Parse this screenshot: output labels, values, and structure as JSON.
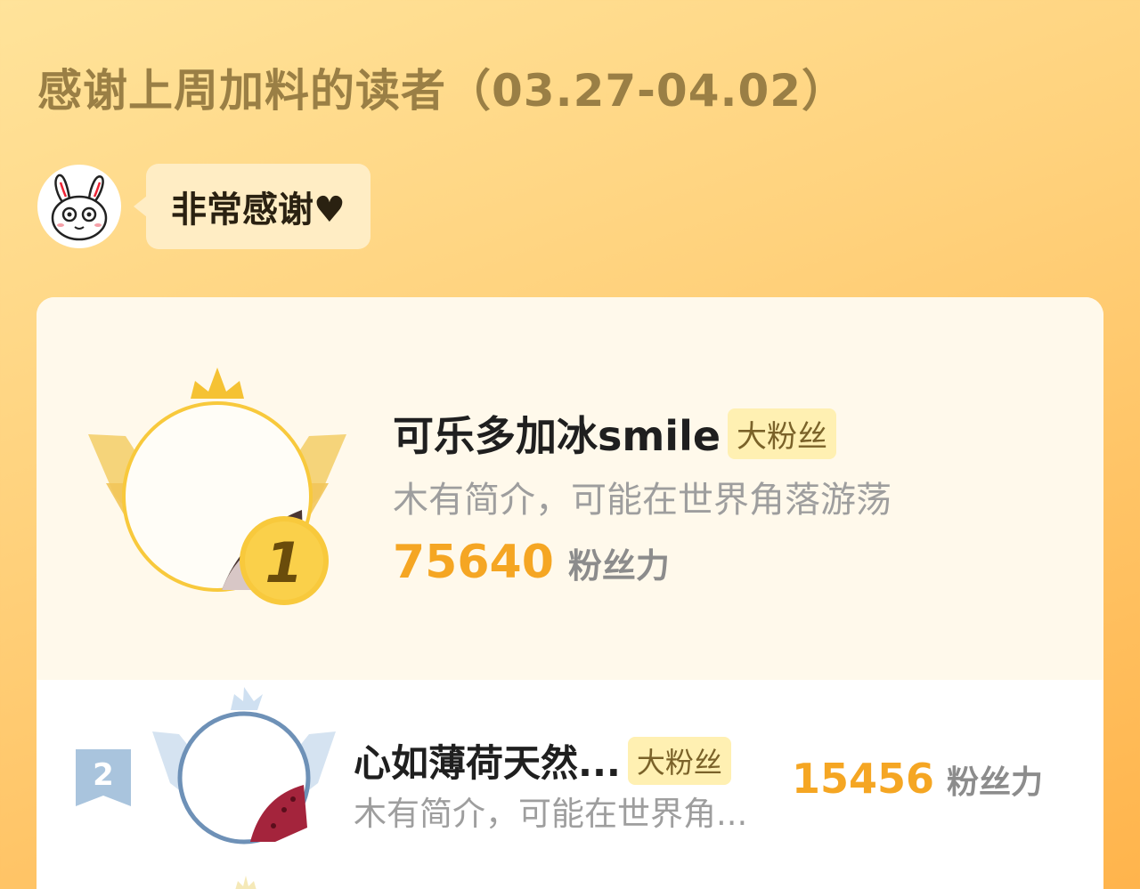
{
  "header": {
    "title": "感谢上周加料的读者（03.27-04.02）",
    "message": "非常感谢♥",
    "mascot_icon": "rabbit-avatar-icon"
  },
  "leaderboard": [
    {
      "rank": "1",
      "name": "可乐多加冰smile",
      "badge": "大粉丝",
      "bio": "木有简介，可能在世界角落游荡",
      "score": "75640",
      "unit": "粉丝力"
    },
    {
      "rank": "2",
      "name": "心如薄荷天然...",
      "badge": "大粉丝",
      "bio": "木有简介，可能在世界角...",
      "score": "15456",
      "unit": "粉丝力"
    }
  ],
  "colors": {
    "accent": "#f5a623",
    "title": "#9a7f45",
    "badge_bg": "#fff0b2",
    "card_bg": "#fff9eb"
  }
}
